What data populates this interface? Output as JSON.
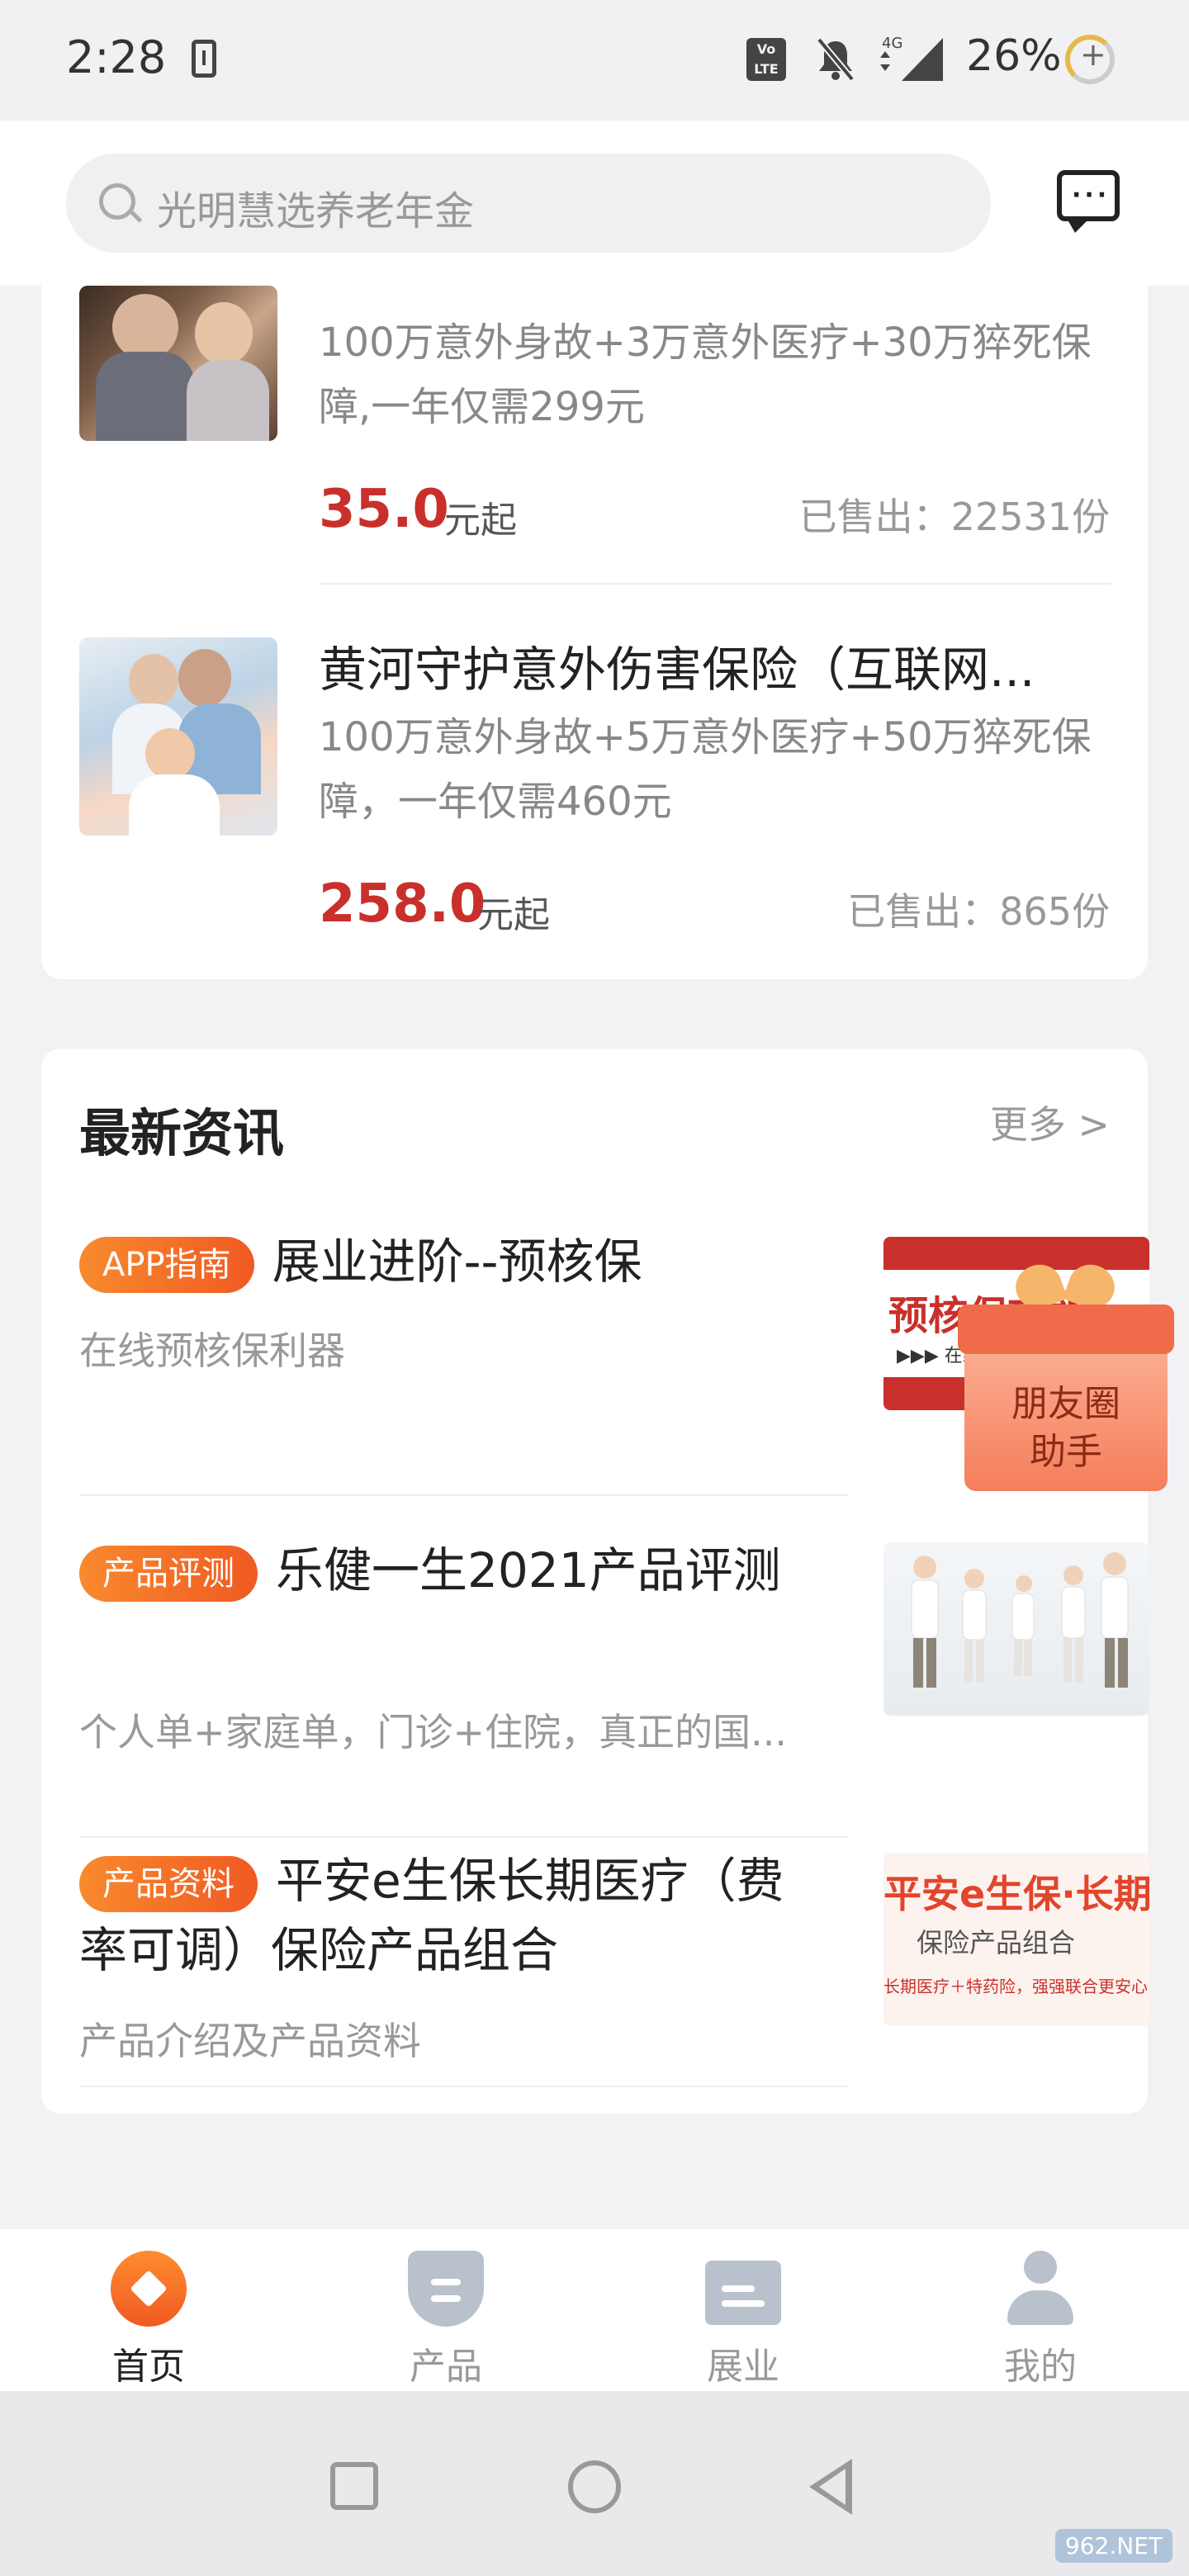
{
  "status_bar": {
    "time": "2:28",
    "volte": "Vo LTE",
    "network": "4G",
    "battery": "26%"
  },
  "header": {
    "search_placeholder": "光明慧选养老年金"
  },
  "products": [
    {
      "title": "",
      "desc": "100万意外身故+3万意外医疗+30万猝死保障,一年仅需299元",
      "price": "35.0",
      "price_suffix": "元起",
      "sold": "已售出：22531份"
    },
    {
      "title": "黄河守护意外伤害保险（互联网...",
      "desc": "100万意外身故+5万意外医疗+50万猝死保障，一年仅需460元",
      "price": "258.0",
      "price_suffix": "元起",
      "sold": "已售出：865份"
    }
  ],
  "news": {
    "title": "最新资讯",
    "more": "更多 >",
    "items": [
      {
        "tag": "APP指南",
        "headline": "展业进阶--预核保",
        "sub": "在线预核保利器",
        "thumb_text": "预核保功能",
        "thumb_sub": "▶▶▶  在线预核保利器"
      },
      {
        "tag": "产品评测",
        "headline": "乐健一生2021产品评测",
        "sub": "个人单+家庭单，门诊+住院，真正的国..."
      },
      {
        "tag": "产品资料",
        "headline": "平安e生保长期医疗（费率可调）保险产品组合",
        "sub": "产品介绍及产品资料",
        "thumb_title": "平安e生保·长期医疗",
        "thumb_sub": "保险产品组合",
        "thumb_foot": "长期医疗＋特药险，强强联合更安心"
      }
    ]
  },
  "gift": {
    "label_line1": "朋友圈",
    "label_line2": "助手"
  },
  "tabs": [
    {
      "label": "首页",
      "icon": "home-icon",
      "active": true
    },
    {
      "label": "产品",
      "icon": "shield-icon"
    },
    {
      "label": "展业",
      "icon": "folder-icon"
    },
    {
      "label": "我的",
      "icon": "user-icon"
    }
  ],
  "watermark": "962.NET",
  "colors": {
    "accent": "#f05a22",
    "price": "#c9302c"
  }
}
